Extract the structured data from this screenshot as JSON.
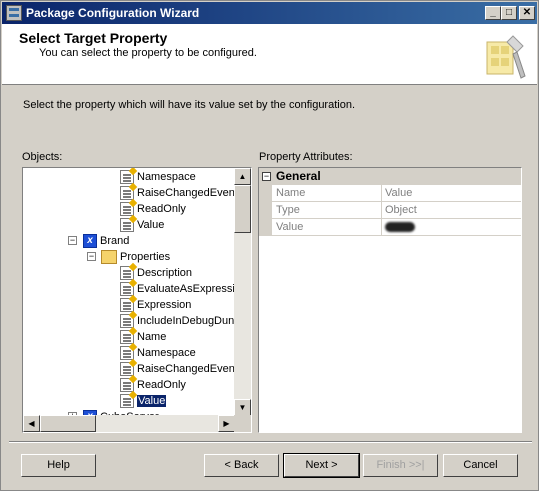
{
  "window": {
    "title": "Package Configuration Wizard",
    "minimize": "_",
    "maximize": "□",
    "close": "✕"
  },
  "header": {
    "title": "Select Target Property",
    "subtitle": "You can select the property to be configured."
  },
  "instruction": "Select the property which will have its value set by the configuration.",
  "objects_label": "Objects:",
  "attributes_label": "Property Attributes:",
  "tree": {
    "items": [
      {
        "label": "Namespace",
        "icon": "property-icon"
      },
      {
        "label": "RaiseChangedEven",
        "icon": "property-icon"
      },
      {
        "label": "ReadOnly",
        "icon": "property-icon"
      },
      {
        "label": "Value",
        "icon": "property-icon"
      },
      {
        "label": "Brand",
        "icon": "variable-icon",
        "expander": "−"
      },
      {
        "label": "Properties",
        "icon": "folder-open-icon",
        "expander": "−"
      },
      {
        "label": "Description",
        "icon": "property-icon"
      },
      {
        "label": "EvaluateAsExpressi",
        "icon": "property-icon"
      },
      {
        "label": "Expression",
        "icon": "property-icon"
      },
      {
        "label": "IncludeInDebugDun",
        "icon": "property-icon"
      },
      {
        "label": "Name",
        "icon": "property-icon"
      },
      {
        "label": "Namespace",
        "icon": "property-icon"
      },
      {
        "label": "RaiseChangedEven",
        "icon": "property-icon"
      },
      {
        "label": "ReadOnly",
        "icon": "property-icon"
      },
      {
        "label": "Value",
        "icon": "property-icon",
        "selected": true
      },
      {
        "label": "CubeServer",
        "icon": "variable-icon",
        "expander": "+"
      }
    ],
    "var_glyph": "x"
  },
  "attributes": {
    "category": "General",
    "category_expander": "−",
    "rows": [
      {
        "name": "Name",
        "value": "Value"
      },
      {
        "name": "Type",
        "value": "Object"
      },
      {
        "name": "Value",
        "value": ""
      }
    ]
  },
  "buttons": {
    "help": "Help",
    "back": "< Back",
    "next": "Next >",
    "finish": "Finish >>|",
    "cancel": "Cancel"
  },
  "scroll": {
    "up": "▲",
    "down": "▼",
    "left": "◀",
    "right": "▶"
  }
}
